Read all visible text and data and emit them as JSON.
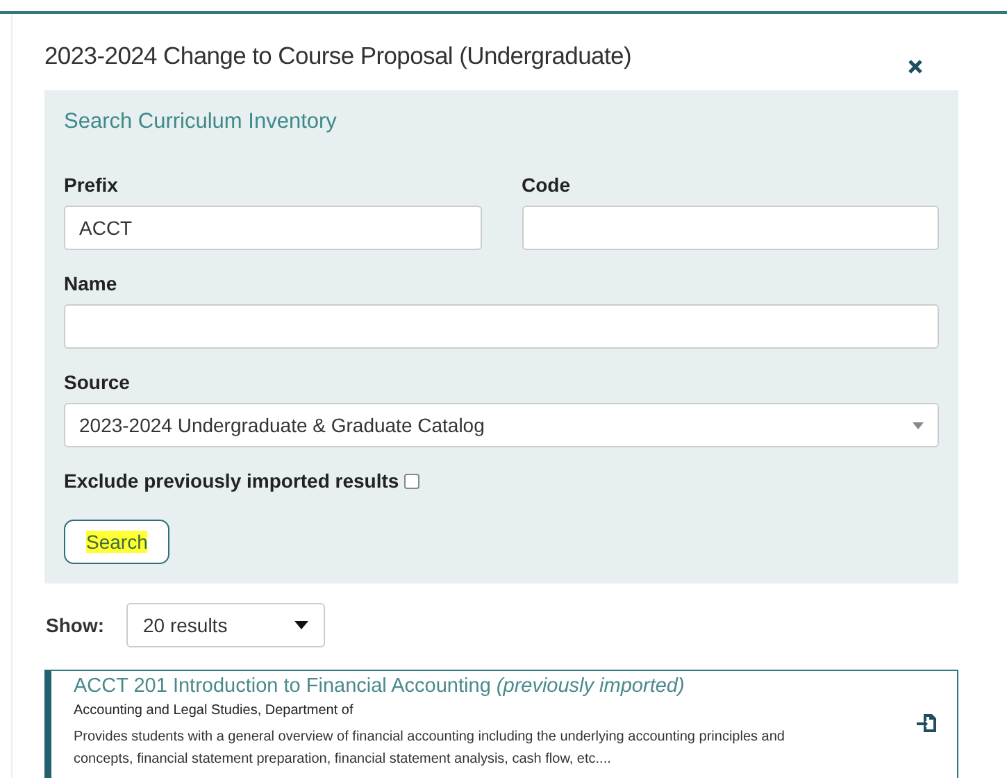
{
  "dialog": {
    "title": "2023-2024 Change to Course Proposal (Undergraduate)"
  },
  "search_panel": {
    "heading": "Search Curriculum Inventory",
    "fields": [
      {
        "label": "Prefix",
        "value": "ACCT"
      },
      {
        "label": "Code"
      },
      {
        "label": "Name"
      }
    ],
    "source": {
      "label": "Source",
      "value": "2023-2024 Undergraduate & Graduate Catalog"
    },
    "exclude": {
      "label": "Exclude previously imported results",
      "checked": false
    },
    "search_button": {
      "label": "Search",
      "highlighted": true
    }
  },
  "show": {
    "label": "Show:",
    "value": "20 results"
  },
  "results": [
    {
      "title": "ACCT 201 Introduction to Financial Accounting",
      "note": "(previously imported)",
      "department": "Accounting and Legal Studies, Department of",
      "description": "Provides students with a general overview of financial accounting including the underlying accounting principles and concepts, financial statement preparation, financial statement analysis, cash flow, etc...."
    }
  ]
}
